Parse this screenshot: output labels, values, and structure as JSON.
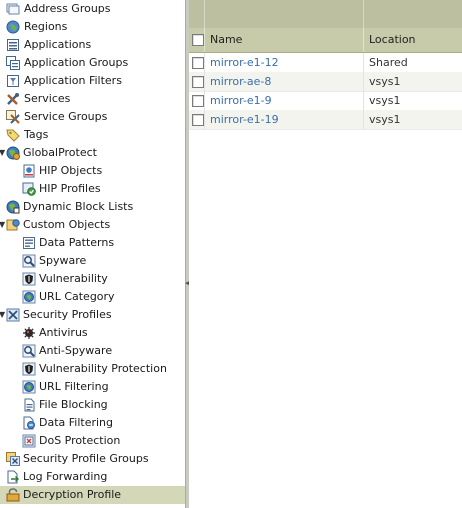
{
  "tree": {
    "items": [
      {
        "label": "Address Groups",
        "icon": "address-groups-icon"
      },
      {
        "label": "Regions",
        "icon": "regions-icon"
      },
      {
        "label": "Applications",
        "icon": "applications-icon"
      },
      {
        "label": "Application Groups",
        "icon": "application-groups-icon"
      },
      {
        "label": "Application Filters",
        "icon": "application-filters-icon"
      },
      {
        "label": "Services",
        "icon": "services-icon"
      },
      {
        "label": "Service Groups",
        "icon": "service-groups-icon"
      },
      {
        "label": "Tags",
        "icon": "tags-icon"
      },
      {
        "label": "GlobalProtect",
        "icon": "globalprotect-icon",
        "expanded": true
      },
      {
        "label": "HIP Objects",
        "icon": "hip-objects-icon"
      },
      {
        "label": "HIP Profiles",
        "icon": "hip-profiles-icon"
      },
      {
        "label": "Dynamic Block Lists",
        "icon": "dynamic-block-lists-icon"
      },
      {
        "label": "Custom Objects",
        "icon": "custom-objects-icon",
        "expanded": true
      },
      {
        "label": "Data Patterns",
        "icon": "data-patterns-icon"
      },
      {
        "label": "Spyware",
        "icon": "spyware-icon"
      },
      {
        "label": "Vulnerability",
        "icon": "vulnerability-icon"
      },
      {
        "label": "URL Category",
        "icon": "url-category-icon"
      },
      {
        "label": "Security Profiles",
        "icon": "security-profiles-icon",
        "expanded": true
      },
      {
        "label": "Antivirus",
        "icon": "antivirus-icon"
      },
      {
        "label": "Anti-Spyware",
        "icon": "anti-spyware-icon"
      },
      {
        "label": "Vulnerability Protection",
        "icon": "vulnerability-protection-icon"
      },
      {
        "label": "URL Filtering",
        "icon": "url-filtering-icon"
      },
      {
        "label": "File Blocking",
        "icon": "file-blocking-icon"
      },
      {
        "label": "Data Filtering",
        "icon": "data-filtering-icon"
      },
      {
        "label": "DoS Protection",
        "icon": "dos-protection-icon"
      },
      {
        "label": "Security Profile Groups",
        "icon": "security-profile-groups-icon"
      },
      {
        "label": "Log Forwarding",
        "icon": "log-forwarding-icon"
      },
      {
        "label": "Decryption Profile",
        "icon": "decryption-profile-icon",
        "selected": true
      }
    ]
  },
  "table": {
    "columns": [
      "Name",
      "Location"
    ],
    "rows": [
      {
        "name": "mirror-e1-12",
        "location": "Shared"
      },
      {
        "name": "mirror-ae-8",
        "location": "vsys1"
      },
      {
        "name": "mirror-e1-9",
        "location": "vsys1"
      },
      {
        "name": "mirror-e1-19",
        "location": "vsys1"
      }
    ]
  },
  "colors": {
    "header": "#c8cbaa",
    "selection": "#d4d8b8",
    "link": "#3a6fa8"
  }
}
